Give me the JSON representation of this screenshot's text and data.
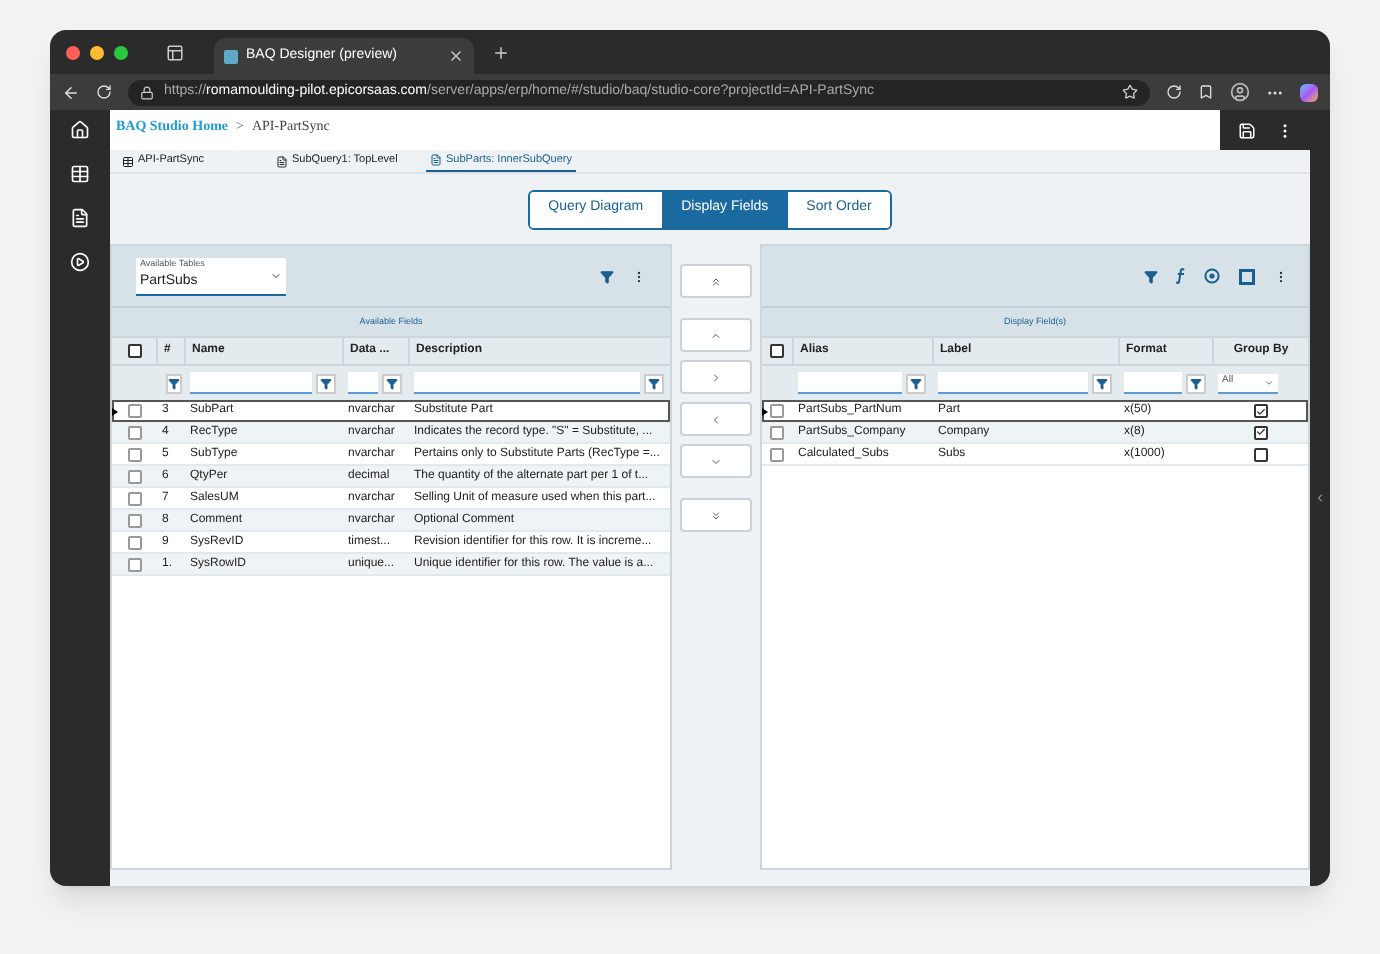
{
  "browser": {
    "tab_title": "BAQ Designer (preview)",
    "url": "https://**romamoulding-pilot.epicorsaas.com**/server/apps/erp/home/#/studio/baq/studio-core?projectId=API-PartSync"
  },
  "breadcrumb": {
    "home": "BAQ Studio Home",
    "separator": ">",
    "current": "API-PartSync"
  },
  "query_tabs": [
    {
      "label": "API-PartSync",
      "kind": "table",
      "selected": false
    },
    {
      "label": "SubQuery1: TopLevel",
      "kind": "doc",
      "selected": false
    },
    {
      "label": "SubParts: InnerSubQuery",
      "kind": "doc",
      "selected": true
    }
  ],
  "view_tabs": [
    {
      "label": "Query Diagram",
      "selected": false
    },
    {
      "label": "Display Fields",
      "selected": true
    },
    {
      "label": "Sort Order",
      "selected": false
    }
  ],
  "available": {
    "table_label": "Available Tables",
    "table_value": "PartSubs",
    "band": "Available Fields",
    "columns": [
      "#",
      "Name",
      "Data ...",
      "Description"
    ],
    "select_all": false,
    "rows": [
      {
        "num": "3",
        "name": "SubPart",
        "type": "nvarchar",
        "desc": "Substitute Part",
        "current": true,
        "checked": false
      },
      {
        "num": "4",
        "name": "RecType",
        "type": "nvarchar",
        "desc": "Indicates the record type. \"S\" = Substitute, ...",
        "current": false,
        "checked": false
      },
      {
        "num": "5",
        "name": "SubType",
        "type": "nvarchar",
        "desc": "Pertains only to Substitute Parts (RecType =...",
        "current": false,
        "checked": false
      },
      {
        "num": "6",
        "name": "QtyPer",
        "type": "decimal",
        "desc": "The quantity of the alternate part per 1 of t...",
        "current": false,
        "checked": false
      },
      {
        "num": "7",
        "name": "SalesUM",
        "type": "nvarchar",
        "desc": "Selling Unit of measure used when this part...",
        "current": false,
        "checked": false
      },
      {
        "num": "8",
        "name": "Comment",
        "type": "nvarchar",
        "desc": "Optional Comment",
        "current": false,
        "checked": false
      },
      {
        "num": "9",
        "name": "SysRevID",
        "type": "timest...",
        "desc": "Revision identifier for this row. It is increme...",
        "current": false,
        "checked": false
      },
      {
        "num": "1.",
        "name": "SysRowID",
        "type": "unique...",
        "desc": "Unique identifier for this row. The value is a...",
        "current": false,
        "checked": false
      }
    ]
  },
  "display": {
    "band": "Display Field(s)",
    "columns": [
      "Alias",
      "Label",
      "Format",
      "Group By"
    ],
    "select_all": false,
    "group_filter": "All",
    "rows": [
      {
        "alias": "PartSubs_PartNum",
        "label": "Part",
        "format": "x(50)",
        "group_by": true,
        "current": true,
        "checked": false
      },
      {
        "alias": "PartSubs_Company",
        "label": "Company",
        "format": "x(8)",
        "group_by": true,
        "current": false,
        "checked": false
      },
      {
        "alias": "Calculated_Subs",
        "label": "Subs",
        "format": "x(1000)",
        "group_by": false,
        "current": false,
        "checked": false
      }
    ]
  }
}
